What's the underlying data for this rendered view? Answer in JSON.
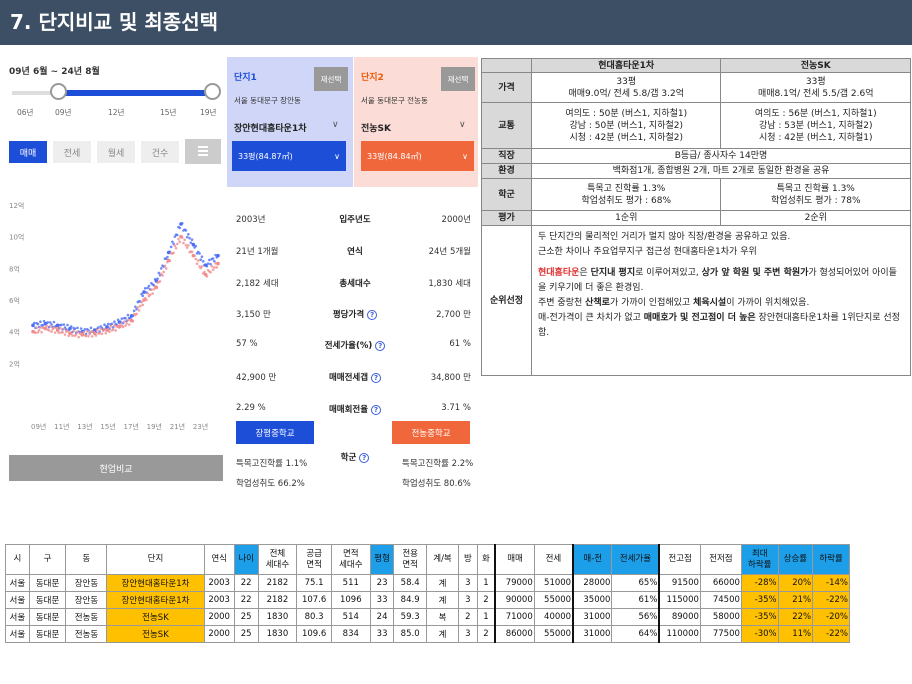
{
  "header": {
    "title": "7. 단지비교 및 최종선택"
  },
  "left": {
    "period": "09년 6월 ~ 24년 8월",
    "slider_years": [
      "06년",
      "09년",
      "12년",
      "15년",
      "19년"
    ],
    "range_fill_pct": 95,
    "tabs": [
      "매매",
      "전세",
      "월세",
      "건수"
    ],
    "chart_ylabels": [
      "12억",
      "10억",
      "8억",
      "6억",
      "4억",
      "2억"
    ],
    "chart_xlabels": [
      "09년",
      "11년",
      "13년",
      "15년",
      "17년",
      "19년",
      "21년",
      "23년"
    ],
    "compare_button": "현업비교"
  },
  "chart_data": {
    "type": "scatter",
    "title": "",
    "xlabel": "",
    "ylabel": "",
    "x": [
      "09년",
      "10년",
      "11년",
      "12년",
      "13년",
      "14년",
      "15년",
      "16년",
      "17년",
      "18년",
      "19년",
      "20년",
      "21년",
      "22년",
      "23년",
      "24년"
    ],
    "ylim": [
      0,
      12
    ],
    "series": [
      {
        "values": [
          4.4,
          4.5,
          4.4,
          4.2,
          4.0,
          4.1,
          4.3,
          4.6,
          5.0,
          6.5,
          7.2,
          9.0,
          10.8,
          9.5,
          8.2,
          8.8
        ],
        "color": "#4c6ef5"
      },
      {
        "values": [
          4.0,
          4.2,
          4.1,
          3.9,
          3.8,
          3.9,
          4.1,
          4.3,
          4.7,
          6.0,
          6.8,
          8.5,
          10.0,
          8.8,
          7.6,
          8.3
        ],
        "color": "#f08c8c"
      }
    ]
  },
  "complex1": {
    "tag": "단지1",
    "reselect": "재선택",
    "address": "서울 동대문구 장안동",
    "name": "장안현대홈타운1차",
    "size": "33평(84.87㎡)"
  },
  "complex2": {
    "tag": "단지2",
    "reselect": "재선택",
    "address": "서울 동대문구 전농동",
    "name": "전농SK",
    "size": "33평(84.84㎡)"
  },
  "compare_rows": [
    {
      "label": "입주년도",
      "left": "2003년",
      "right": "2000년",
      "help": false
    },
    {
      "label": "연식",
      "left": "21년 1개월",
      "right": "24년 5개월",
      "help": false
    },
    {
      "label": "총세대수",
      "left": "2,182 세대",
      "right": "1,830 세대",
      "help": false
    },
    {
      "label": "평당가격",
      "left": "3,150 만",
      "right": "2,700 만",
      "help": true
    },
    {
      "label": "전세가율(%)",
      "left": "57 %",
      "right": "61 %",
      "help": true
    },
    {
      "label": "매매전세갭",
      "left": "42,900 만",
      "right": "34,800 만",
      "help": true
    },
    {
      "label": "매매회전율",
      "left": "2.29 %",
      "right": "3.71 %",
      "help": true
    }
  ],
  "school": {
    "left_btn": "장평중학교",
    "right_btn": "전농중학교",
    "label": "학군",
    "left_rate": "특목고진학률 1.1%",
    "left_score": "학업성취도 66.2%",
    "right_rate": "특목고진학률 2.2%",
    "right_score": "학업성취도 80.6%"
  },
  "right_table": {
    "col1": "현대홈타운1차",
    "col2": "전농SK",
    "price_label": "가격",
    "price1_a": "33평",
    "price1_b": "매매9.0억/ 전세 5.8/갭 3.2억",
    "price2_a": "33평",
    "price2_b": "매매8.1억/ 전세 5.5/갭 2.6억",
    "traffic_label": "교통",
    "traffic1": [
      "여의도 : 50분 (버스1, 지하철1)",
      "강남   : 50분 (버스1, 지하철2)",
      "시청 : 42분 (버스1, 지하철2)"
    ],
    "traffic2": [
      "여의도 : 56분 (버스1, 지하철1)",
      "강남   : 53분 (버스1, 지하철2)",
      "시청 : 42분 (버스1, 지하철1)"
    ],
    "job_label": "직장",
    "job": "B등급/ 종사자수 14만명",
    "env_label": "환경",
    "env": "백화점1개, 종합병원 2개, 마트 2개로 동일한 환경을 공유",
    "school_label": "학군",
    "school1": [
      "특목고 진학률 1.3%",
      "학업성취도 평가 : 68%"
    ],
    "school2": [
      "특목고 진학률 1.3%",
      "학업성취도 평가 : 78%"
    ],
    "rank_label": "평가",
    "rank1": "1순위",
    "rank2": "2순위",
    "choice_label": "순위선정",
    "choice_p1": "두 단지간의 물리적인 거리가 멀지 않아 직장/환경을 공유하고 있음.",
    "choice_p2": "근소한 차이나 주요업무지구 접근성 현대홈타운1차가 우위",
    "choice_hl1": "현대홈타운",
    "choice_t1": "은 ",
    "choice_b1": "단지내 평지",
    "choice_t2": "로 이루어져있고, ",
    "choice_b2": "상가 앞 학원 및 주변 학원가",
    "choice_t3": "가 형성되어있어 아이들을 키우기에 더 좋은 환경임.",
    "choice_t4": "주변 중랑천 ",
    "choice_b3": "산책로",
    "choice_t5": "가 가까이 인접해있고 ",
    "choice_b4": "체육시설",
    "choice_t6": "이 가까이 위치해있음.",
    "choice_t7": "매-전가격이 큰 차치가 없고 ",
    "choice_b5": "매매호가 및 전고점이 더 높은",
    "choice_t8": " 장안현대홈타운1차를 1위단지로 선정함."
  },
  "bottom_table": {
    "headers": [
      "시",
      "구",
      "동",
      "단지",
      "연식",
      "나이",
      "전체\n세대수",
      "공급\n면적",
      "면적\n세대수",
      "평형",
      "전용\n면적",
      "계/복",
      "방",
      "화",
      "매매",
      "전세",
      "매-전",
      "전세가율",
      "전고점",
      "전저점",
      "최대\n하락률",
      "상승률",
      "하락률"
    ],
    "rows": [
      [
        "서울",
        "동대문",
        "장안동",
        "장안현대홈타운1차",
        "2003",
        "22",
        "2182",
        "75.1",
        "511",
        "23",
        "58.4",
        "계",
        "3",
        "1",
        "79000",
        "51000",
        "28000",
        "65%",
        "91500",
        "66000",
        "-28%",
        "20%",
        "-14%"
      ],
      [
        "서울",
        "동대문",
        "장안동",
        "장안현대홈타운1차",
        "2003",
        "22",
        "2182",
        "107.6",
        "1096",
        "33",
        "84.9",
        "계",
        "3",
        "2",
        "90000",
        "55000",
        "35000",
        "61%",
        "115000",
        "74500",
        "-35%",
        "21%",
        "-22%"
      ],
      [
        "서울",
        "동대문",
        "전농동",
        "전농SK",
        "2000",
        "25",
        "1830",
        "80.3",
        "514",
        "24",
        "59.3",
        "복",
        "2",
        "1",
        "71000",
        "40000",
        "31000",
        "56%",
        "89000",
        "58000",
        "-35%",
        "22%",
        "-20%"
      ],
      [
        "서울",
        "동대문",
        "전농동",
        "전농SK",
        "2000",
        "25",
        "1830",
        "109.6",
        "834",
        "33",
        "85.0",
        "계",
        "3",
        "2",
        "86000",
        "55000",
        "31000",
        "64%",
        "110000",
        "77500",
        "-30%",
        "11%",
        "-22%"
      ]
    ]
  }
}
